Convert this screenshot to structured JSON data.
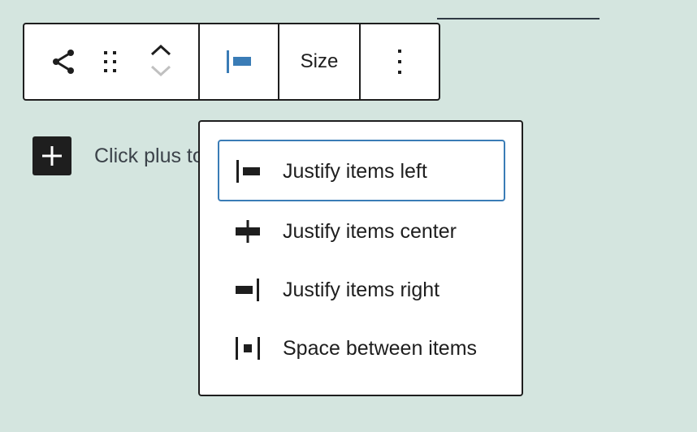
{
  "toolbar": {
    "parent_icon": "share-icon",
    "drag_icon": "drag-handle-icon",
    "move_up_icon": "chevron-up-icon",
    "move_down_icon": "chevron-down-icon",
    "justify_icon": "justify-left-icon",
    "size_label": "Size",
    "options_icon": "more-vertical-icon"
  },
  "inserter": {
    "icon": "plus-icon"
  },
  "placeholder": {
    "text": "Click plus to add"
  },
  "justify_menu": {
    "items": [
      {
        "label": "Justify items left",
        "icon": "justify-left-icon",
        "selected": true
      },
      {
        "label": "Justify items center",
        "icon": "justify-center-icon",
        "selected": false
      },
      {
        "label": "Justify items right",
        "icon": "justify-right-icon",
        "selected": false
      },
      {
        "label": "Space between items",
        "icon": "justify-space-between-icon",
        "selected": false
      }
    ]
  },
  "colors": {
    "background": "#d4e5df",
    "accent": "#3a7cb6",
    "border": "#1e1e1e"
  }
}
